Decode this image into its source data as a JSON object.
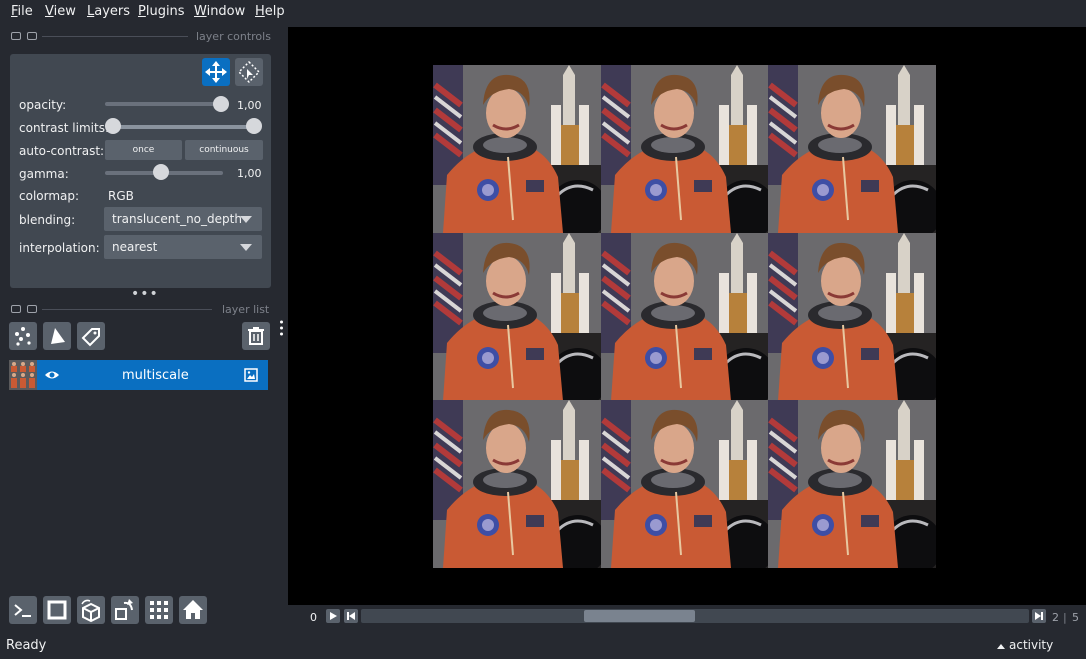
{
  "menu": {
    "items": [
      {
        "first": "F",
        "rest": "ile"
      },
      {
        "first": "V",
        "rest": "iew"
      },
      {
        "first": "L",
        "rest": "ayers"
      },
      {
        "first": "P",
        "rest": "lugins"
      },
      {
        "first": "W",
        "rest": "indow"
      },
      {
        "first": "H",
        "rest": "elp"
      }
    ]
  },
  "layer_controls": {
    "title": "layer controls",
    "opacity_label": "opacity:",
    "opacity_value": "1,00",
    "opacity_level": 1.0,
    "contrast_label": "contrast limits:",
    "auto_contrast_label": "auto-contrast:",
    "once_label": "once",
    "continuous_label": "continuous",
    "gamma_label": "gamma:",
    "gamma_value": "1,00",
    "colormap_label": "colormap:",
    "colormap_value": "RGB",
    "blending_label": "blending:",
    "blending_value": "translucent_no_depth",
    "interpolation_label": "interpolation:",
    "interpolation_value": "nearest"
  },
  "layer_list": {
    "title": "layer list",
    "layers": [
      {
        "name": "multiscale",
        "visible": true,
        "selected": true
      }
    ]
  },
  "dims": {
    "current_value": "0",
    "frame_current": "2",
    "frame_total": "5"
  },
  "status": {
    "text": "Ready",
    "activity_label": "activity"
  },
  "colors": {
    "background": "#262930",
    "panel": "#414851",
    "accent": "#0a6fc1",
    "canvas": "#000000"
  },
  "icons": [
    "move-icon",
    "transform-icon",
    "points-icon",
    "shapes-icon",
    "labels-icon",
    "delete-icon",
    "console-icon",
    "ndisplay-icon",
    "roll-icon",
    "transpose-icon",
    "grid-icon",
    "home-icon",
    "eye-icon",
    "image-icon"
  ]
}
